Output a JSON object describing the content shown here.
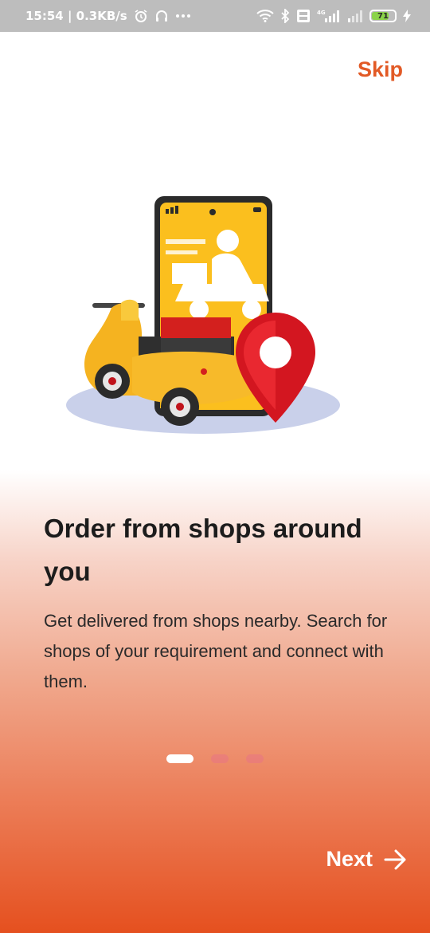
{
  "status_bar": {
    "time_speed": "15:54 | 0.3KB/s",
    "network": "4G",
    "battery": "71"
  },
  "onboarding": {
    "skip_label": "Skip",
    "title": "Order from shops around you",
    "description": "Get delivered from shops nearby. Search for shops of your requirement and connect with them.",
    "next_label": "Next",
    "page_index": 1,
    "page_count": 3
  },
  "colors": {
    "accent": "#e25a26",
    "gradient_bottom": "#e5501f",
    "phone_screen": "#fbbf1e",
    "pin": "#d31620"
  },
  "icons": {
    "status": [
      "alarm-icon",
      "headset-icon",
      "more-icon",
      "wifi-icon",
      "bluetooth-icon",
      "volte-icon",
      "signal-icon",
      "battery-icon",
      "charging-icon"
    ],
    "next": "arrow-right-icon"
  }
}
